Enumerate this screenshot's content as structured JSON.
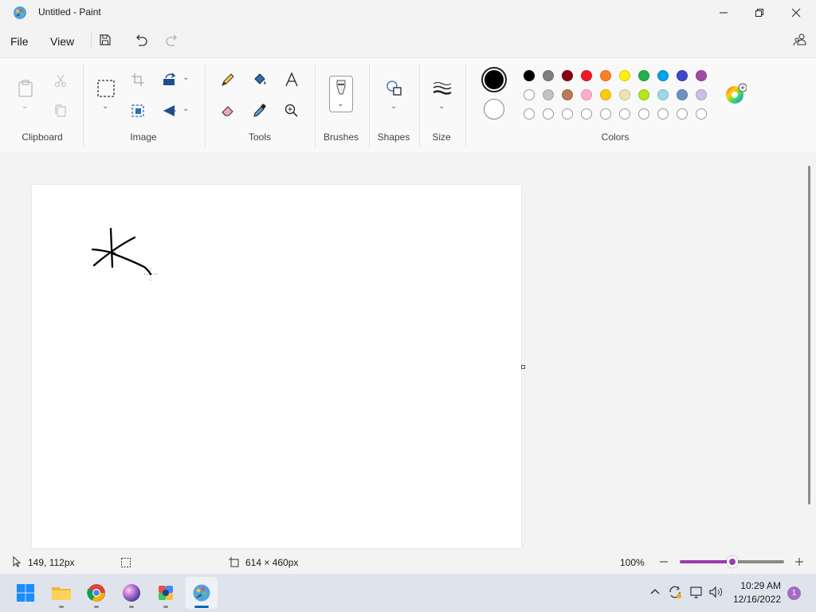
{
  "window": {
    "title": "Untitled - Paint",
    "app_icon": "paint-palette-icon"
  },
  "menu": {
    "file": "File",
    "view": "View"
  },
  "ribbon": {
    "groups": {
      "clipboard": "Clipboard",
      "image": "Image",
      "tools": "Tools",
      "brushes": "Brushes",
      "shapes": "Shapes",
      "size": "Size",
      "colors": "Colors"
    },
    "colors": {
      "primary": "#000000",
      "secondary": "#ffffff",
      "palette_row1": [
        "#000000",
        "#7f7f7f",
        "#880015",
        "#ed1c24",
        "#ff7f27",
        "#fff200",
        "#22b14c",
        "#00a2e8",
        "#3f48cc",
        "#a349a4"
      ],
      "palette_row2": [
        "#ffffff",
        "#c3c3c3",
        "#b97a57",
        "#ffaec9",
        "#ffc90e",
        "#efe4b0",
        "#b5e61d",
        "#99d9ea",
        "#7092be",
        "#c8bfe7"
      ],
      "palette_row3": [
        "#ffffff",
        "#ffffff",
        "#ffffff",
        "#ffffff",
        "#ffffff",
        "#ffffff",
        "#ffffff",
        "#ffffff",
        "#ffffff",
        "#ffffff"
      ]
    }
  },
  "status": {
    "cursor_position": "149, 112px",
    "canvas_size": "614 × 460px",
    "zoom": "100%",
    "zoom_level": 0.5
  },
  "taskbar": {
    "time": "10:29 AM",
    "date": "12/16/2022",
    "notification_count": "1",
    "accent": "#0067c0"
  }
}
